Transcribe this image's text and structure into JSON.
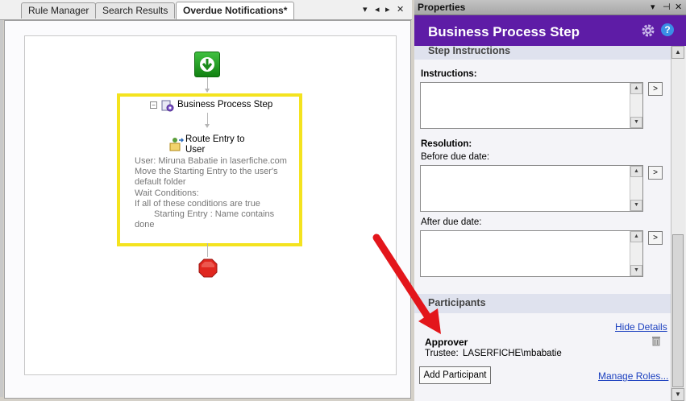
{
  "tabs": [
    {
      "label": "Rule Manager",
      "active": false
    },
    {
      "label": "Search Results",
      "active": false
    },
    {
      "label": "Overdue Notifications*",
      "active": true
    }
  ],
  "tab_controls": {
    "pin": "▾",
    "prev": "◂",
    "next": "▸",
    "close": "✕"
  },
  "workflow": {
    "step_title": "Business Process Step",
    "collapse_symbol": "⊟",
    "route_title": "Route Entry to User",
    "route_details": [
      "User: Miruna Babatie in laserfiche.com",
      "Move the Starting Entry to the user's default folder",
      "Wait Conditions:",
      "If all of these conditions are true",
      "Starting Entry : Name contains done"
    ],
    "step_highlight_color": "#f4e31f"
  },
  "properties": {
    "pane_title": "Properties",
    "title_controls": {
      "menu": "▾",
      "pin": "⊣",
      "close": "✕"
    },
    "header_title": "Business Process Step",
    "header_color": "#5e1ca6",
    "help_glyph": "?",
    "section_step_instructions": "Step Instructions",
    "instructions_label": "Instructions:",
    "resolution_label": "Resolution:",
    "before_due_label": "Before due date:",
    "after_due_label": "After due date:",
    "expand_glyph": ">",
    "section_participants": "Participants",
    "hide_details": "Hide Details",
    "approver_label": "Approver",
    "trustee_label": "Trustee:",
    "trustee_value": "LASERFICHE\\mbabatie",
    "add_participant": "Add Participant",
    "manage_roles": "Manage Roles..."
  },
  "annotation": {
    "arrow_color": "#e3161b"
  }
}
